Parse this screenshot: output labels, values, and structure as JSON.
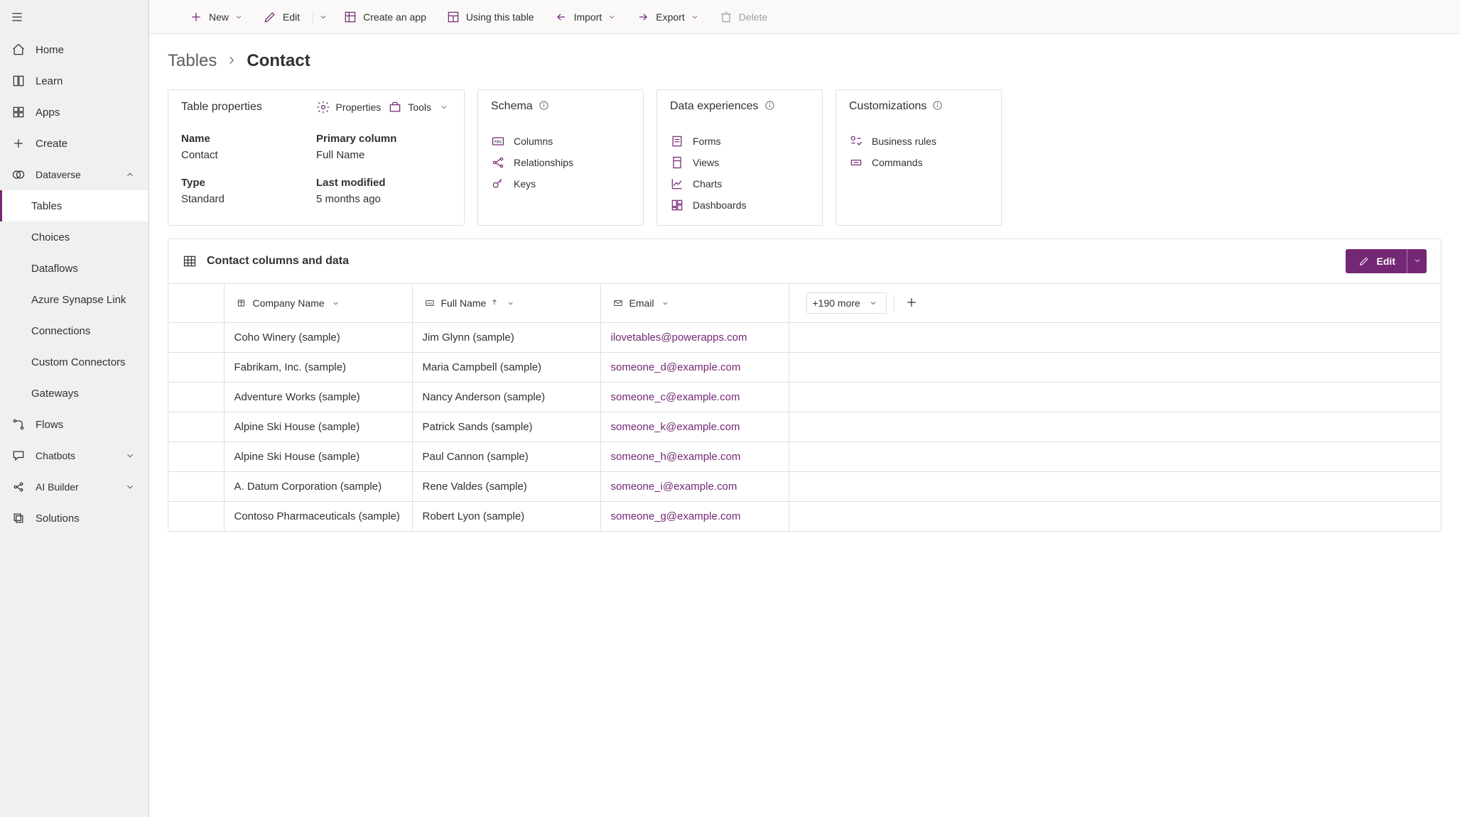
{
  "toolbar": {
    "new": "New",
    "edit": "Edit",
    "create_app": "Create an app",
    "using_table": "Using this table",
    "import": "Import",
    "export": "Export",
    "delete": "Delete"
  },
  "sidebar": {
    "items": {
      "home": "Home",
      "learn": "Learn",
      "apps": "Apps",
      "create": "Create",
      "dataverse": "Dataverse",
      "tables": "Tables",
      "choices": "Choices",
      "dataflows": "Dataflows",
      "synapse": "Azure Synapse Link",
      "connections": "Connections",
      "custom_connectors": "Custom Connectors",
      "gateways": "Gateways",
      "flows": "Flows",
      "chatbots": "Chatbots",
      "ai_builder": "AI Builder",
      "solutions": "Solutions"
    }
  },
  "breadcrumb": {
    "root": "Tables",
    "current": "Contact"
  },
  "props_card": {
    "title": "Table properties",
    "action_properties": "Properties",
    "action_tools": "Tools",
    "name_lbl": "Name",
    "name_val": "Contact",
    "primary_lbl": "Primary column",
    "primary_val": "Full Name",
    "type_lbl": "Type",
    "type_val": "Standard",
    "modified_lbl": "Last modified",
    "modified_val": "5 months ago"
  },
  "schema_card": {
    "title": "Schema",
    "columns": "Columns",
    "relationships": "Relationships",
    "keys": "Keys"
  },
  "de_card": {
    "title": "Data experiences",
    "forms": "Forms",
    "views": "Views",
    "charts": "Charts",
    "dashboards": "Dashboards"
  },
  "cust_card": {
    "title": "Customizations",
    "rules": "Business rules",
    "commands": "Commands"
  },
  "data": {
    "title": "Contact columns and data",
    "edit": "Edit",
    "more": "+190 more",
    "columns": {
      "company": "Company Name",
      "fullname": "Full Name",
      "email": "Email"
    },
    "rows": [
      {
        "company": "Coho Winery (sample)",
        "fullname": "Jim Glynn (sample)",
        "email": "ilovetables@powerapps.com"
      },
      {
        "company": "Fabrikam, Inc. (sample)",
        "fullname": "Maria Campbell (sample)",
        "email": "someone_d@example.com"
      },
      {
        "company": "Adventure Works (sample)",
        "fullname": "Nancy Anderson (sample)",
        "email": "someone_c@example.com"
      },
      {
        "company": "Alpine Ski House (sample)",
        "fullname": "Patrick Sands (sample)",
        "email": "someone_k@example.com"
      },
      {
        "company": "Alpine Ski House (sample)",
        "fullname": "Paul Cannon (sample)",
        "email": "someone_h@example.com"
      },
      {
        "company": "A. Datum Corporation (sample)",
        "fullname": "Rene Valdes (sample)",
        "email": "someone_i@example.com"
      },
      {
        "company": "Contoso Pharmaceuticals (sample)",
        "fullname": "Robert Lyon (sample)",
        "email": "someone_g@example.com"
      }
    ]
  }
}
